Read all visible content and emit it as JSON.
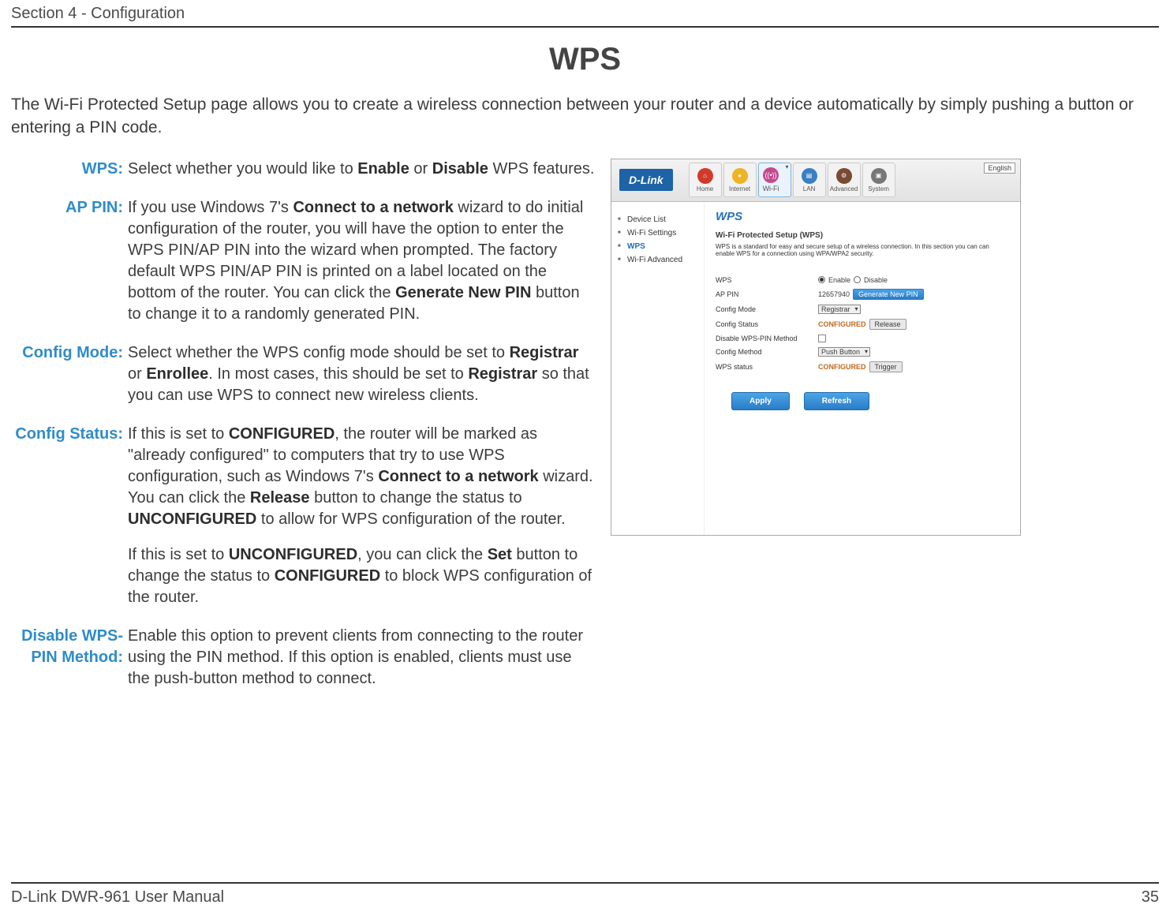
{
  "header": {
    "section": "Section 4 - Configuration"
  },
  "title": "WPS",
  "intro": "The Wi-Fi Protected Setup page allows you to create a wireless connection between your router and a device automatically by simply pushing a button or entering a PIN code.",
  "defs": {
    "wps": {
      "label": "WPS:",
      "text": "Select whether you would like to <b>Enable</b> or <b>Disable</b> WPS features."
    },
    "appin": {
      "label": "AP PIN:",
      "text": "If you use Windows 7's <b>Connect to a network</b> wizard to do initial configuration of the router, you will have the option to enter the WPS PIN/AP PIN into the wizard when prompted. The factory default WPS PIN/AP PIN is printed on a label located on the bottom of the router. You can click the <b>Generate New PIN</b> button to change it to a randomly generated PIN."
    },
    "cfgmode": {
      "label": "Config Mode:",
      "text": "Select whether the WPS config mode should be set to <b>Registrar</b> or <b>Enrollee</b>. In most cases, this should be set to <b>Registrar</b> so that you can use WPS to connect new wireless clients."
    },
    "cfgstatus": {
      "label": "Config Status:",
      "p1": "If this is set to <b>CONFIGURED</b>, the router will be marked as \"already configured\" to computers that try to use WPS configuration, such as Windows 7's <b>Connect to a network</b> wizard. You can click the <b>Release</b> button to change the status to <b>UNCONFIGURED</b> to allow for WPS configuration of the router.",
      "p2": "If this is set to <b>UNCONFIGURED</b>, you can click the <b>Set</b> button to change the status to <b>CONFIGURED</b> to block WPS configuration of the router."
    },
    "disablepin": {
      "label": "Disable WPS-PIN Method:",
      "text": "Enable this option to prevent clients from connecting to the router using the PIN method. If this option is enabled, clients must use the push-button method to connect."
    }
  },
  "shot": {
    "logo": "D-Link",
    "lang": "English",
    "nav": [
      {
        "label": "Home"
      },
      {
        "label": "Internet"
      },
      {
        "label": "Wi-Fi"
      },
      {
        "label": "LAN"
      },
      {
        "label": "Advanced"
      },
      {
        "label": "System"
      }
    ],
    "sidebar": [
      {
        "label": "Device List"
      },
      {
        "label": "Wi-Fi Settings"
      },
      {
        "label": "WPS"
      },
      {
        "label": "Wi-Fi Advanced"
      }
    ],
    "panel": {
      "heading": "WPS",
      "subheading": "Wi-Fi Protected Setup (WPS)",
      "desc": "WPS is a standard for easy and secure setup of a wireless connection. In this section you can can enable WPS for a connection using WPA/WPA2 security.",
      "rows": {
        "wps_label": "WPS",
        "enable": "Enable",
        "disable": "Disable",
        "appin_label": "AP PIN",
        "appin_value": "12657940",
        "gen": "Generate New PIN",
        "cfgmode_label": "Config Mode",
        "cfgmode_value": "Registrar",
        "cfgstatus_label": "Config Status",
        "cfgstatus_value": "CONFIGURED",
        "release": "Release",
        "disablepin_label": "Disable WPS-PIN Method",
        "cfgmethod_label": "Config Method",
        "cfgmethod_value": "Push Button",
        "wpsstatus_label": "WPS status",
        "wpsstatus_value": "CONFIGURED",
        "trigger": "Trigger"
      },
      "apply": "Apply",
      "refresh": "Refresh"
    }
  },
  "footer": {
    "manual": "D-Link DWR-961 User Manual",
    "page": "35"
  }
}
